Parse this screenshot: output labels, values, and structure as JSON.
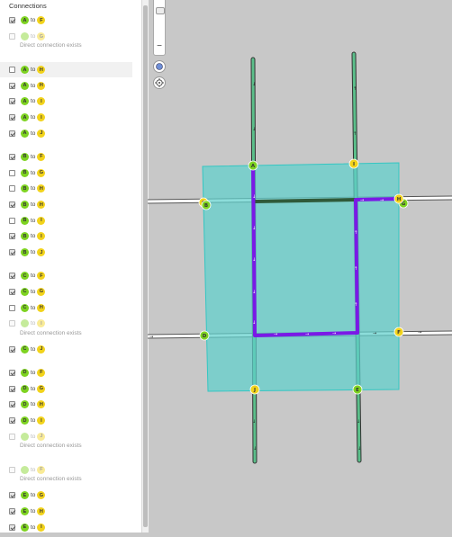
{
  "panel": {
    "title": "Connections",
    "groups": [
      {
        "items": [
          {
            "from": "A",
            "to": "F",
            "checked": true
          },
          {
            "from": "",
            "to": "G",
            "disabled": true,
            "note": "Direct connection exists"
          }
        ]
      },
      {
        "items": [
          {
            "from": "A",
            "to": "H",
            "checked": false,
            "highlight": true
          },
          {
            "from": "A",
            "to": "H",
            "checked": true
          },
          {
            "from": "A",
            "to": "I",
            "checked": true
          },
          {
            "from": "A",
            "to": "I",
            "checked": true
          },
          {
            "from": "A",
            "to": "J",
            "checked": true
          }
        ]
      },
      {
        "items": [
          {
            "from": "B",
            "to": "F",
            "checked": true
          },
          {
            "from": "B",
            "to": "G",
            "checked": false
          },
          {
            "from": "B",
            "to": "H",
            "checked": false
          },
          {
            "from": "B",
            "to": "H",
            "checked": true
          },
          {
            "from": "B",
            "to": "I",
            "checked": false
          },
          {
            "from": "B",
            "to": "I",
            "checked": true
          },
          {
            "from": "B",
            "to": "J",
            "checked": true
          }
        ]
      },
      {
        "items": [
          {
            "from": "C",
            "to": "F",
            "checked": true
          },
          {
            "from": "C",
            "to": "G",
            "checked": true
          },
          {
            "from": "C",
            "to": "H",
            "checked": false
          },
          {
            "from": "",
            "to": "I",
            "disabled": true,
            "note": "Direct connection exists"
          },
          {
            "from": "C",
            "to": "J",
            "checked": true
          }
        ]
      },
      {
        "items": [
          {
            "from": "D",
            "to": "F",
            "checked": true
          },
          {
            "from": "D",
            "to": "G",
            "checked": true
          },
          {
            "from": "D",
            "to": "H",
            "checked": true
          },
          {
            "from": "D",
            "to": "I",
            "checked": true
          },
          {
            "from": "",
            "to": "J",
            "disabled": true,
            "note": "Direct connection exists"
          }
        ]
      },
      {
        "items": [
          {
            "from": "",
            "to": "F",
            "disabled": true,
            "note": "Direct connection exists"
          },
          {
            "from": "E",
            "to": "G",
            "checked": true
          },
          {
            "from": "E",
            "to": "H",
            "checked": true
          },
          {
            "from": "E",
            "to": "I",
            "checked": true
          },
          {
            "from": "E",
            "to": "J",
            "checked": true
          }
        ]
      }
    ],
    "to_word": "to"
  },
  "map": {
    "nodes": [
      "A",
      "B",
      "C",
      "D",
      "E",
      "F",
      "G",
      "H",
      "I",
      "J"
    ],
    "colors": {
      "from_badge": "#7ed321",
      "to_badge": "#f2d31b",
      "zone_fill": "#5fd0cc",
      "route": "#7a19e6",
      "road": "#3fa56a",
      "background": "#c8c8c8"
    }
  }
}
